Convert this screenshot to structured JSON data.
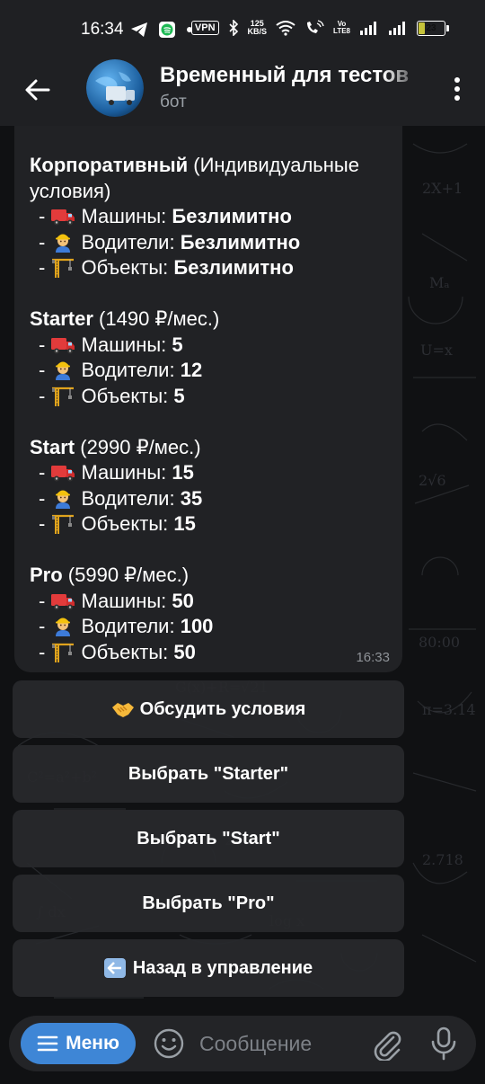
{
  "status_bar": {
    "time": "16:34",
    "vpn": "VPN",
    "speed_value": "125",
    "speed_unit": "KB/S",
    "volte_top": "Vo",
    "volte_bottom": "LTE8",
    "battery_level": "23",
    "battery_fill": 0.23,
    "accent_battery": "#c6c33a"
  },
  "header": {
    "title": "Временный для тестов",
    "subtitle": "бот",
    "back_icon": "arrow-left-icon",
    "more_icon": "more-vertical-icon"
  },
  "message": {
    "time": "16:33",
    "plans": [
      {
        "name": "Корпоративный",
        "price": " (Индивидуальные условия)",
        "items": [
          {
            "icon": "truck-icon",
            "label": "Машины: ",
            "value": "Безлимитно"
          },
          {
            "icon": "worker-icon",
            "label": "Водители: ",
            "value": "Безлимитно"
          },
          {
            "icon": "construction-crane-icon",
            "label": "Объекты: ",
            "value": "Безлимитно"
          }
        ]
      },
      {
        "name": "Starter",
        "price": " (1490 ₽/мес.)",
        "items": [
          {
            "icon": "truck-icon",
            "label": "Машины: ",
            "value": "5"
          },
          {
            "icon": "worker-icon",
            "label": "Водители: ",
            "value": "12"
          },
          {
            "icon": "construction-crane-icon",
            "label": "Объекты: ",
            "value": "5"
          }
        ]
      },
      {
        "name": "Start",
        "price": " (2990 ₽/мес.)",
        "items": [
          {
            "icon": "truck-icon",
            "label": "Машины: ",
            "value": "15"
          },
          {
            "icon": "worker-icon",
            "label": "Водители: ",
            "value": "35"
          },
          {
            "icon": "construction-crane-icon",
            "label": "Объекты: ",
            "value": "15"
          }
        ]
      },
      {
        "name": "Pro",
        "price": " (5990 ₽/мес.)",
        "items": [
          {
            "icon": "truck-icon",
            "label": "Машины: ",
            "value": "50"
          },
          {
            "icon": "worker-icon",
            "label": "Водители: ",
            "value": "100"
          },
          {
            "icon": "construction-crane-icon",
            "label": "Объекты: ",
            "value": "50"
          }
        ]
      }
    ]
  },
  "keyboard": {
    "discuss": {
      "label": "Обсудить условия",
      "icon": "handshake-icon"
    },
    "starter": {
      "label": "Выбрать \"Starter\""
    },
    "start": {
      "label": "Выбрать \"Start\""
    },
    "pro": {
      "label": "Выбрать \"Pro\""
    },
    "back": {
      "label": "Назад в управление",
      "icon": "back-arrow-emoji-icon"
    }
  },
  "input_bar": {
    "menu_label": "Меню",
    "placeholder": "Сообщение",
    "accent": "#3e86d6"
  }
}
